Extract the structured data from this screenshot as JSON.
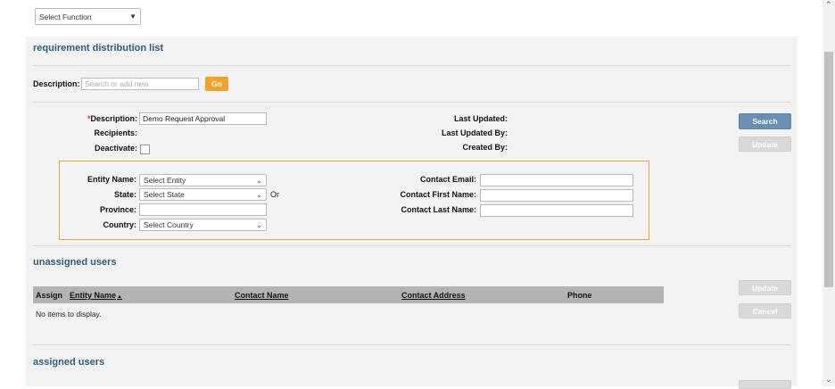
{
  "function_select": {
    "value": "Select Function"
  },
  "panel": {
    "title": "requirement distribution list",
    "search": {
      "label": "Description:",
      "placeholder": "Search or add new",
      "go_label": "Go"
    },
    "details": {
      "required_mark": "*",
      "description_label": "Description:",
      "description_value": "Demo Request Approval",
      "recipients_label": "Recipients:",
      "deactivate_label": "Deactivate:",
      "last_updated_label": "Last Updated:",
      "last_updated_by_label": "Last Updated By:",
      "created_by_label": "Created By:",
      "search_button": "Search",
      "update_button": "Update"
    },
    "filters": {
      "entity_name_label": "Entity Name:",
      "entity_name_value": "Select Entity",
      "state_label": "State:",
      "state_value": "Select State",
      "or_label": "Or",
      "province_label": "Province:",
      "country_label": "Country:",
      "country_value": "Select Country",
      "contact_email_label": "Contact Email:",
      "contact_first_name_label": "Contact First Name:",
      "contact_last_name_label": "Contact Last Name:"
    },
    "unassigned": {
      "title": "unassigned users",
      "columns": {
        "assign": "Assign",
        "entity_name": "Entity Name",
        "sort_glyph": "▲",
        "contact_name": "Contact Name",
        "contact_address": "Contact Address",
        "phone": "Phone"
      },
      "empty_text": "No items to display.",
      "update_button": "Update",
      "cancel_button": "Cancel"
    },
    "assigned": {
      "title": "assigned users"
    }
  },
  "colors": {
    "accent": "#2b5f7a",
    "highlight_border": "#f0a32a",
    "primary_button": "#6790b3",
    "table_header": "#b3b3b3"
  }
}
